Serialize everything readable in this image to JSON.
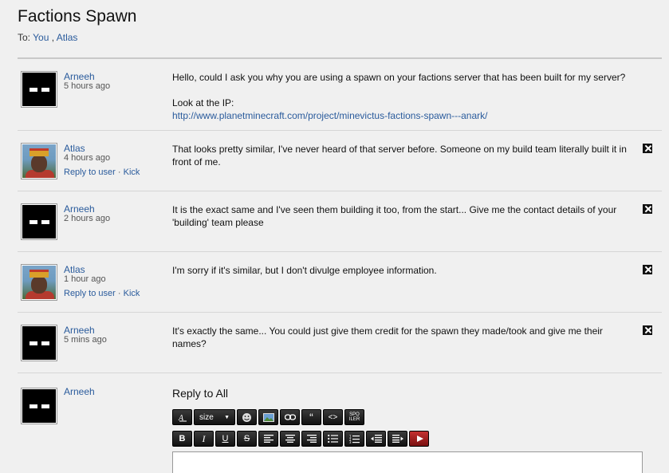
{
  "thread": {
    "title": "Factions Spawn",
    "to_prefix": "To:",
    "recipients": [
      "You",
      "Atlas"
    ],
    "separator": ","
  },
  "messages": [
    {
      "author": "Arneeh",
      "time": "5 hours ago",
      "avatar": "dark-block",
      "paragraphs": [
        "Hello, could I ask you why you are using a spawn on your factions server that has been built for my server?"
      ],
      "look_label": "Look at the IP:",
      "link": "http://www.planetminecraft.com/project/minevictus-factions-spawn---anark/"
    },
    {
      "author": "Atlas",
      "time": "4 hours ago",
      "avatar": "king",
      "reply_label": "Reply to user",
      "dot": "·",
      "kick_label": "Kick",
      "paragraphs": [
        "That looks pretty similar, I've never heard of that server before. Someone on my build team literally built it in front of me."
      ]
    },
    {
      "author": "Arneeh",
      "time": "2 hours ago",
      "avatar": "dark-block",
      "paragraphs": [
        "It is the exact same and I've seen them building it too, from the start... Give me the contact details of your 'building' team please"
      ]
    },
    {
      "author": "Atlas",
      "time": "1 hour ago",
      "avatar": "king",
      "reply_label": "Reply to user",
      "dot": "·",
      "kick_label": "Kick",
      "paragraphs": [
        "I'm sorry if it's similar, but I don't divulge employee information."
      ]
    },
    {
      "author": "Arneeh",
      "time": "5 mins ago",
      "avatar": "dark-block",
      "paragraphs": [
        "It's exactly the same... You could just give them credit for the spawn they made/took and give me their names?"
      ]
    }
  ],
  "reply": {
    "author": "Arneeh",
    "title": "Reply to All",
    "size_label": "size",
    "spoiler_top": "SPO",
    "spoiler_bottom": "ILER",
    "quote_glyph": "“",
    "code_glyph": "<>",
    "bold": "B",
    "italic": "I",
    "underline": "U",
    "strike": "S"
  },
  "icons": {
    "delete": "close-icon",
    "font": "font-color-icon",
    "emoji": "smiley-icon",
    "image": "image-icon",
    "link": "link-icon",
    "youtube": "youtube-icon"
  }
}
